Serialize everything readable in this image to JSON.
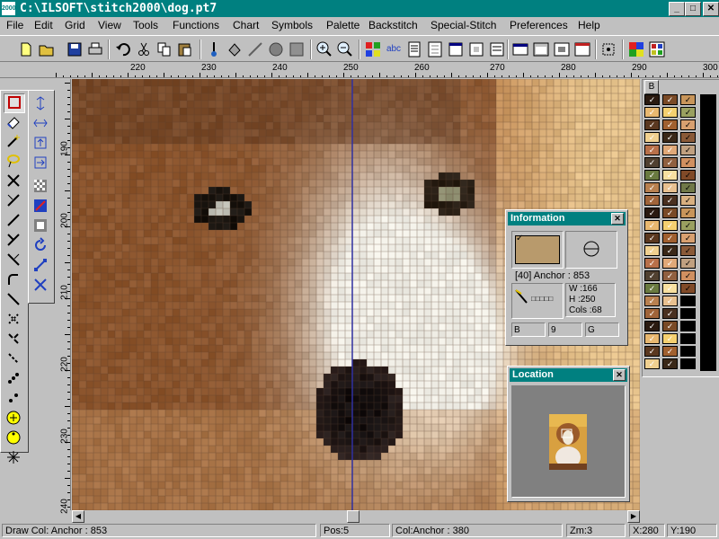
{
  "window": {
    "title": "C:\\ILSOFT\\stitch2000\\dog.pt7",
    "app_icon_text": "2000",
    "minimize": "_",
    "maximize": "□",
    "close": "✕"
  },
  "menu": [
    "File",
    "Edit",
    "Grid",
    "View",
    "Tools",
    "Functions",
    "Chart",
    "Symbols",
    "Palette",
    "Backstitch",
    "Special-Stitch",
    "Preferences",
    "Help"
  ],
  "toolbar": {
    "icons": [
      "new-file-icon",
      "open-folder-icon",
      "save-icon",
      "print-icon",
      "undo-icon",
      "cut-icon",
      "copy-icon",
      "paste-icon",
      "pen-icon",
      "fill-icon",
      "line-icon",
      "circle-icon",
      "square-pattern-icon",
      "zoom-in-icon",
      "zoom-out-icon",
      "color-grid-icon",
      "abc-text-icon",
      "document-icon",
      "palette-icon",
      "window-icon",
      "window2-icon",
      "window3-icon",
      "window4-icon",
      "select-grid-icon",
      "color-swap-icon",
      "color-chart-icon"
    ]
  },
  "ruler": {
    "h_labels": [
      "220",
      "230",
      "240",
      "250",
      "260",
      "270",
      "280",
      "290",
      "300"
    ],
    "v_labels": [
      "190",
      "200",
      "210",
      "220",
      "230",
      "240"
    ]
  },
  "palette": {
    "header_label": "B",
    "colors": [
      "#2a1a10",
      "#7a4a26",
      "#c8955a",
      "#e8b870",
      "#f5d070",
      "#9aa060",
      "#5a3820",
      "#a06030",
      "#d8a070",
      "#f0d090",
      "#3a2818",
      "#8a5a38",
      "#b8704a",
      "#e0a878",
      "#c0a080",
      "#504030",
      "#906040",
      "#d09060",
      "#6a7a40",
      "#f8e0a0",
      "#804a28",
      "#b88050",
      "#e8c090",
      "#707848",
      "#a0643a",
      "#4a3020",
      "#d8b080"
    ]
  },
  "info": {
    "title": "Information",
    "close": "✕",
    "anchor_label": "[40] Anchor : 853",
    "swatch_color": "#b89a6c",
    "width": "W   :166",
    "height": "H    :250",
    "cols": "Cols :68",
    "stitch_dots": "□□□□□",
    "field_b": "B",
    "field_9": "9",
    "field_g": "G"
  },
  "location": {
    "title": "Location",
    "close": "✕"
  },
  "status": {
    "draw_col": "Draw Col: Anchor : 853",
    "pos": "Pos:5",
    "col_anchor": "Col:Anchor : 380",
    "zoom": "Zm:3",
    "x": "X:280",
    "y": "Y:190"
  },
  "colors": {
    "titlebar": "#008080",
    "face": "#c0c0c0",
    "cursor_line": "#3030a0"
  }
}
